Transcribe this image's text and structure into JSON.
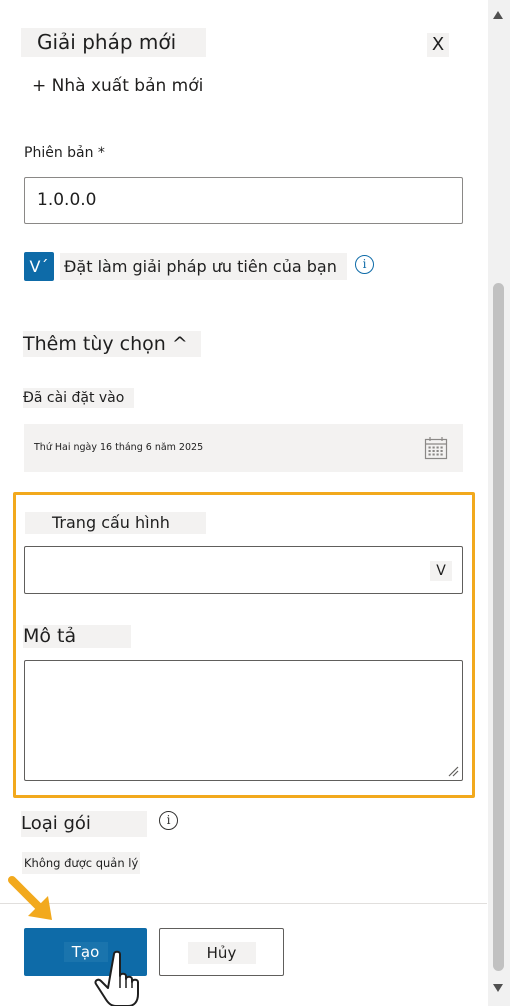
{
  "panel": {
    "title": "Giải pháp mới",
    "close_label": "X",
    "new_publisher_label": "+ Nhà xuất bản mới"
  },
  "version": {
    "label": "Phiên bản *",
    "value": "1.0.0.0"
  },
  "preferred": {
    "checkbox_glyph": "V´",
    "checked": true,
    "label": "Đặt làm giải pháp ưu tiên của bạn",
    "info_glyph": "i"
  },
  "more_options": {
    "label": "Thêm tùy chọn ^"
  },
  "installed_on": {
    "label": "Đã cài đặt vào",
    "value": "Thứ Hai ngày 16 tháng 6 năm 2025",
    "icon": "calendar-icon"
  },
  "config_page": {
    "label": "Trang cấu hình",
    "value": "",
    "chevron": "V"
  },
  "description": {
    "label": "Mô tả",
    "value": ""
  },
  "package_type": {
    "label": "Loại gói",
    "info_glyph": "i",
    "value": "Không được quản lý"
  },
  "footer": {
    "create_label": "Tạo",
    "cancel_label": "Hủy"
  },
  "colors": {
    "accent": "#0e6ba8",
    "highlight": "#f2a91d",
    "chip_bg": "#f3f2f1"
  }
}
